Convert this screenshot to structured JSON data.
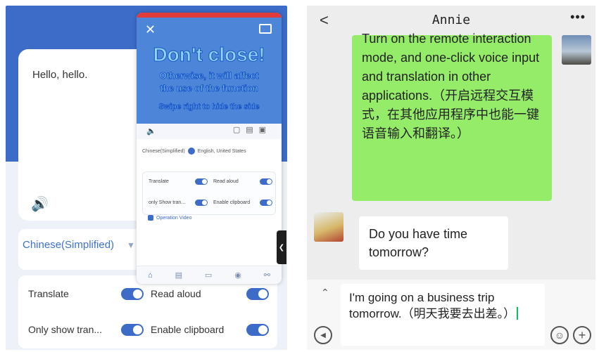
{
  "left_app": {
    "main_text": "Hello, hello.",
    "source_language": "Chinese(Simplified)",
    "options": {
      "translate": "Translate",
      "read_aloud": "Read aloud",
      "only_show": "Only show tran...",
      "enable_clipboard": "Enable clipboard"
    },
    "overlay": {
      "warning_title": "Don't close!",
      "warning_line1": "Otherwise, it will affect",
      "warning_line2": "the use of the function",
      "swipe_hint": "Swipe right to hide the side",
      "lang_from": "Chinese(Simplified)",
      "lang_to": "English, United States",
      "opt_translate": "Translate",
      "opt_read_aloud": "Read aloud",
      "opt_only_show": "only Show tran...",
      "opt_clipboard": "Enable clipboard",
      "guide_link": "Operation Video"
    }
  },
  "chat": {
    "contact_name": "Annie",
    "sent_message": "Turn on the remote interaction mode, and one-click voice input and translation in other applications.（开启远程交互模式，在其他应用程序中也能一键语音输入和翻译。）",
    "received_message": "Do you have time tomorrow?",
    "input_text": "I'm going on a business trip tomorrow.（明天我要去出差。）"
  }
}
